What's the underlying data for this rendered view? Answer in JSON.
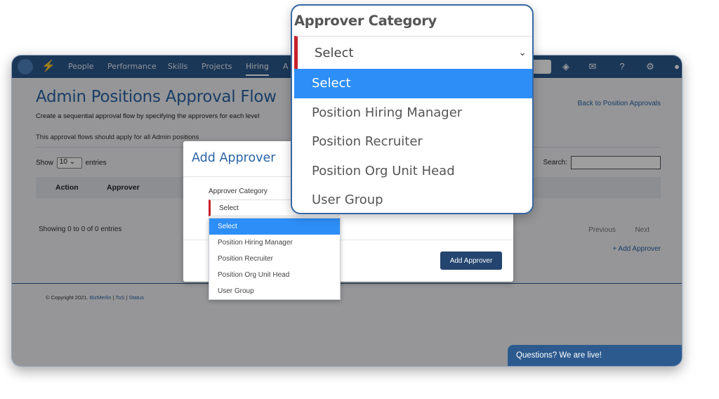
{
  "nav": {
    "items": [
      "People",
      "Performance",
      "Skills",
      "Projects",
      "Hiring",
      "A"
    ],
    "active": "Hiring"
  },
  "page": {
    "title": "Admin Positions Approval Flow",
    "subtitle": "Create a sequential approval flow by specifying the approvers for each level",
    "note": "This approval flows should apply for all Admin positions",
    "back_link": "Back to Position Approvals"
  },
  "table": {
    "show_label": "Show",
    "show_value": "10",
    "entries_label": "entries",
    "search_label": "Search:",
    "columns": [
      "Action",
      "Approver"
    ],
    "showing": "Showing 0 to 0 of 0 entries",
    "previous": "Previous",
    "next": "Next",
    "add_link": "+ Add Approver"
  },
  "footer": {
    "copyright": "© Copyright 2021.",
    "brand": "BizMerlin",
    "tos": "ToS",
    "status": "Status",
    "separator": "|"
  },
  "chat": {
    "label": "Questions? We are live!"
  },
  "modal": {
    "title": "Add Approver",
    "field_label": "Approver Category",
    "selected": "Select",
    "options": [
      "Select",
      "Position Hiring Manager",
      "Position Recruiter",
      "Position Org Unit Head",
      "User Group"
    ],
    "button": "Add Approver"
  },
  "zoom": {
    "label": "Approver Category",
    "selected": "Select",
    "options": [
      "Select",
      "Position Hiring Manager",
      "Position Recruiter",
      "Position Org Unit Head",
      "User Group"
    ]
  },
  "colors": {
    "brand_blue": "#2c5a8f",
    "accent_red": "#c7202b",
    "highlight": "#2d8ef7",
    "button_dark": "#24456f"
  }
}
